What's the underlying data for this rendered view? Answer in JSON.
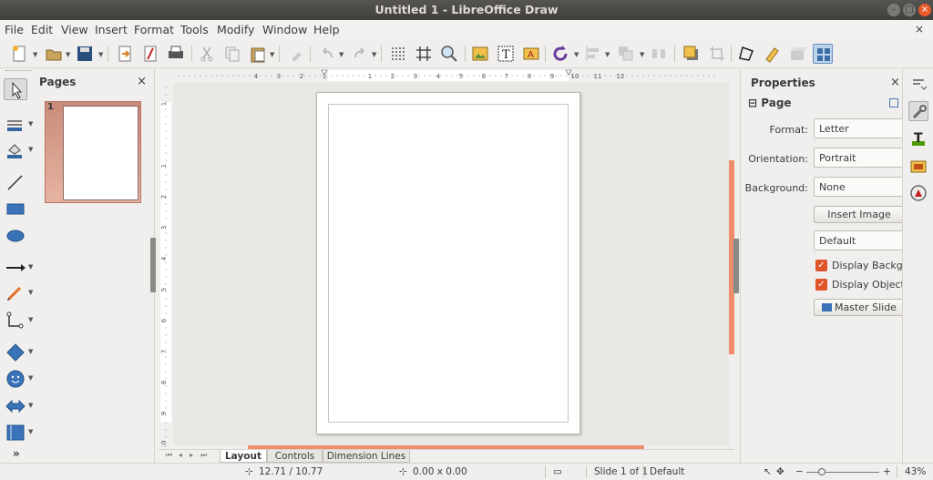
{
  "window": {
    "title": "Untitled 1 - LibreOffice Draw"
  },
  "menu": [
    "File",
    "Edit",
    "View",
    "Insert",
    "Format",
    "Tools",
    "Modify",
    "Window",
    "Help"
  ],
  "doc_close": "×",
  "pages_panel": {
    "title": "Pages",
    "close": "×",
    "thumbnail_number": "1"
  },
  "ruler": {
    "h_labels": [
      "4",
      "3",
      "2",
      "1",
      "1",
      "2",
      "3",
      "4",
      "5",
      "6",
      "7",
      "8",
      "9",
      "10",
      "11",
      "12"
    ],
    "v_labels": [
      "1",
      "1",
      "2",
      "3",
      "4",
      "5",
      "6",
      "7",
      "8",
      "9",
      "10"
    ]
  },
  "tabs": [
    "Layout",
    "Controls",
    "Dimension Lines"
  ],
  "sidebar": {
    "title": "Properties",
    "close": "×",
    "section": "Page",
    "section_toggle": "⊟",
    "format_label": "Format:",
    "format_value": "Letter",
    "orientation_label": "Orientation:",
    "orientation_value": "Portrait",
    "background_label": "Background:",
    "background_value": "None",
    "insert_image": "Insert Image",
    "master_value": "Default",
    "display_background": "Display Backgrou",
    "display_objects": "Display Objects",
    "master_slide": "Master Slide"
  },
  "status": {
    "position": "12.71 / 10.77",
    "size": "0.00 x 0.00",
    "slide": "Slide 1 of 1",
    "master": "Default",
    "zoom": "43%",
    "zoom_minus": "−",
    "zoom_plus": "+"
  },
  "icons": {
    "more_tools": "»"
  }
}
